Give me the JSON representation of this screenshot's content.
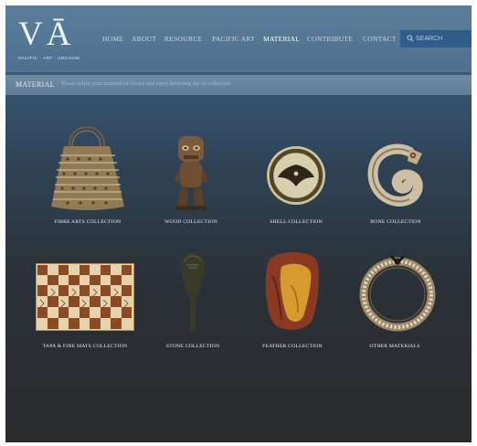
{
  "logo": {
    "title": "VĀ",
    "subtitle": "PACIFIC · ART · ARCHIVE"
  },
  "nav": {
    "items": [
      {
        "label": "HOME"
      },
      {
        "label": "ABOUT"
      },
      {
        "label": "RESOURCE"
      },
      {
        "label": "PACIFIC ART"
      },
      {
        "label": "MATERIAL"
      },
      {
        "label": "CONTRIBUTE"
      },
      {
        "label": "CONTACT"
      }
    ],
    "active": "MATERIAL"
  },
  "search": {
    "placeholder": "SEARCH",
    "value": ""
  },
  "breadcrumb": {
    "title": "MATERIAL",
    "text": "Please select your material of choice and enjoy browsing the vā collection"
  },
  "collections": [
    {
      "label": "FIBRE ARTS COLLECTION",
      "image": "fibre-bag-icon"
    },
    {
      "label": "WOOD COLLECTION",
      "image": "wood-figure-icon"
    },
    {
      "label": "SHELL COLLECTION",
      "image": "shell-disc-icon"
    },
    {
      "label": "BONE COLLECTION",
      "image": "bone-hook-icon"
    },
    {
      "label": "TAPA & FINE MATS COLLECTION",
      "image": "tapa-cloth-icon"
    },
    {
      "label": "STONE COLLECTION",
      "image": "stone-club-icon"
    },
    {
      "label": "FEATHER COLLECTION",
      "image": "feather-object-icon"
    },
    {
      "label": "OTHER MATERIALS",
      "image": "shell-necklace-icon"
    }
  ],
  "colors": {
    "header": "#4e7190",
    "search_box": "#2f5c88",
    "crumb_bar": "#5f7e98",
    "background_bottom": "#2a2b2d"
  }
}
